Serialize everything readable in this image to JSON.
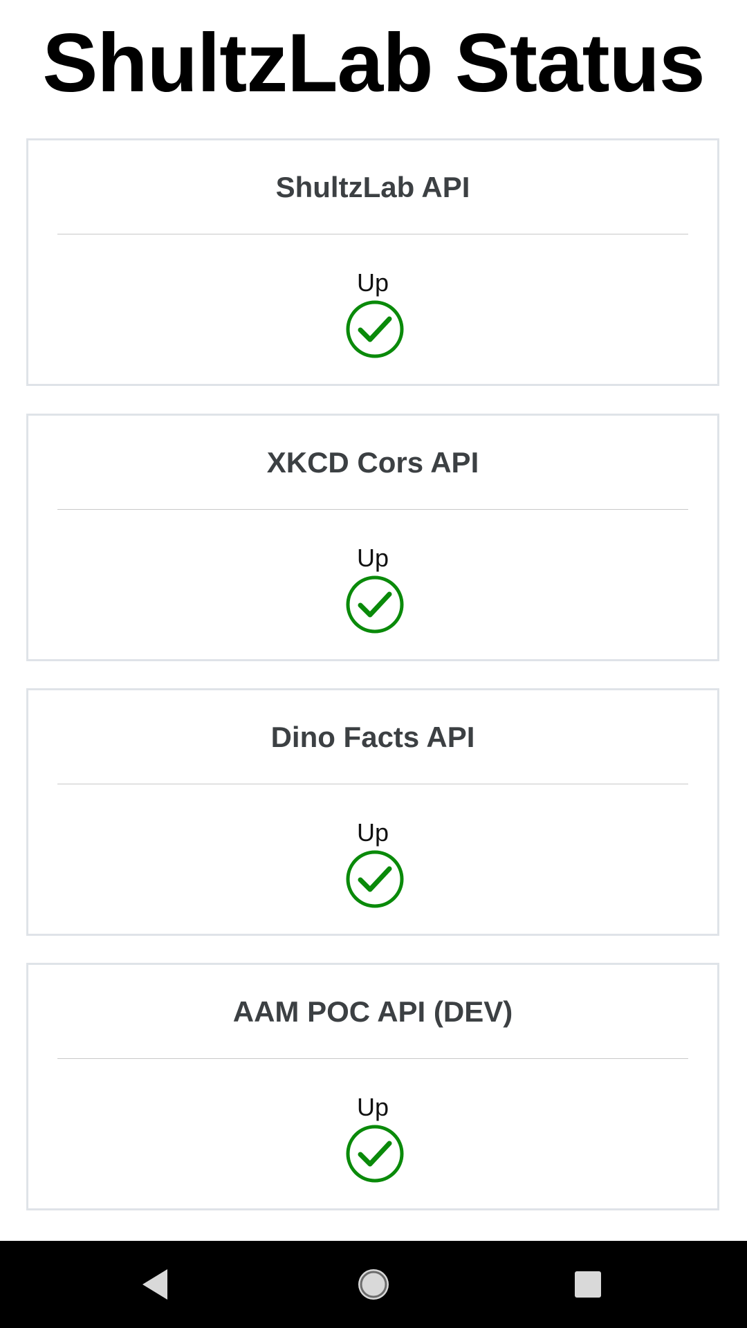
{
  "page": {
    "title": "ShultzLab Status"
  },
  "services": [
    {
      "name": "ShultzLab API",
      "status": "Up",
      "status_icon": "check-circle-icon"
    },
    {
      "name": "XKCD Cors API",
      "status": "Up",
      "status_icon": "check-circle-icon"
    },
    {
      "name": "Dino Facts API",
      "status": "Up",
      "status_icon": "check-circle-icon"
    },
    {
      "name": "AAM POC API (DEV)",
      "status": "Up",
      "status_icon": "check-circle-icon"
    }
  ],
  "colors": {
    "status_up": "#0a8a0a",
    "card_border": "#dfe3e8",
    "card_title": "#3c4043"
  },
  "navbar": {
    "buttons": [
      "back-icon",
      "home-icon",
      "recents-icon"
    ]
  }
}
